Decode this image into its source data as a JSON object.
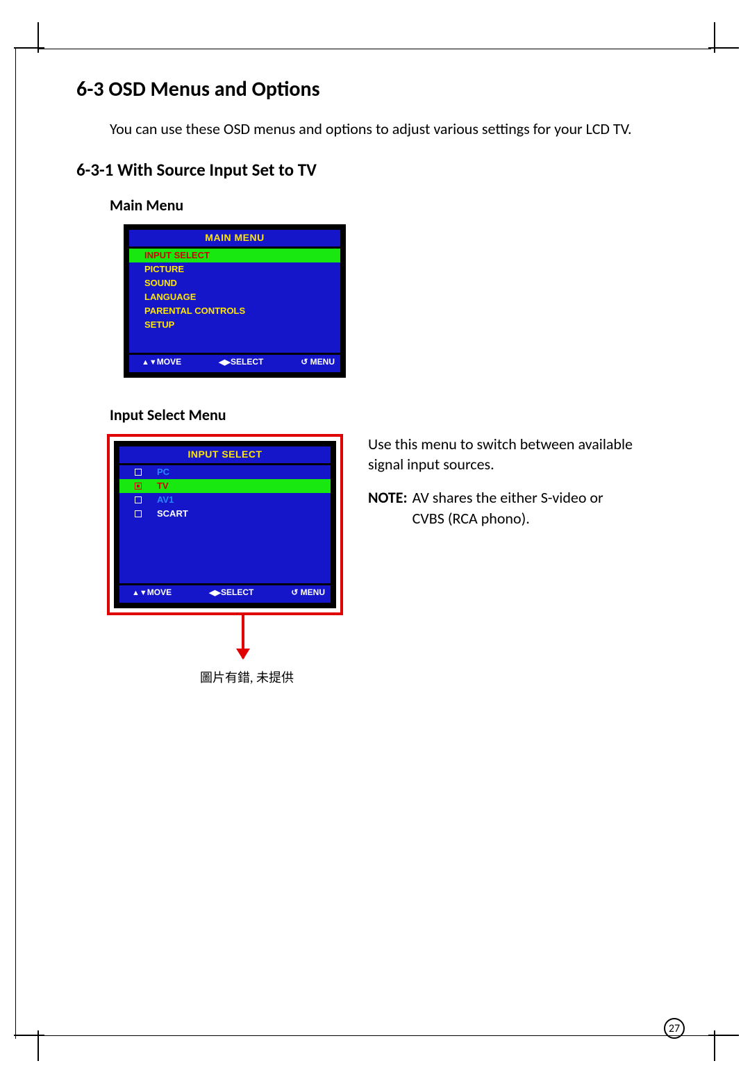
{
  "section_title": "6-3  OSD Menus and Options",
  "intro": "You can use these OSD menus and options to adjust various settings for your LCD TV.",
  "sub_title": "6-3-1  With Source Input Set to TV",
  "fig1": {
    "label": "Main Menu",
    "title": "MAIN MENU",
    "items": [
      "INPUT SELECT",
      "PICTURE",
      "SOUND",
      "LANGUAGE",
      "PARENTAL CONTROLS",
      "SETUP"
    ],
    "selected_index": 0,
    "foot": {
      "move": "MOVE",
      "select": "SELECT",
      "menu": "MENU"
    }
  },
  "fig2": {
    "label": "Input Select Menu",
    "title": "INPUT SELECT",
    "items": [
      "PC",
      "TV",
      "AV1",
      "SCART"
    ],
    "selected_index": 1,
    "foot": {
      "move": "MOVE",
      "select": "SELECT",
      "menu": "MENU"
    },
    "side_para": "Use this menu to switch between available signal input sources.",
    "note_label": "NOTE:",
    "note_body": "AV shares the either S-video or CVBS (RCA phono).",
    "annotation": "圖片有錯,  未提供"
  },
  "page_number": "27"
}
